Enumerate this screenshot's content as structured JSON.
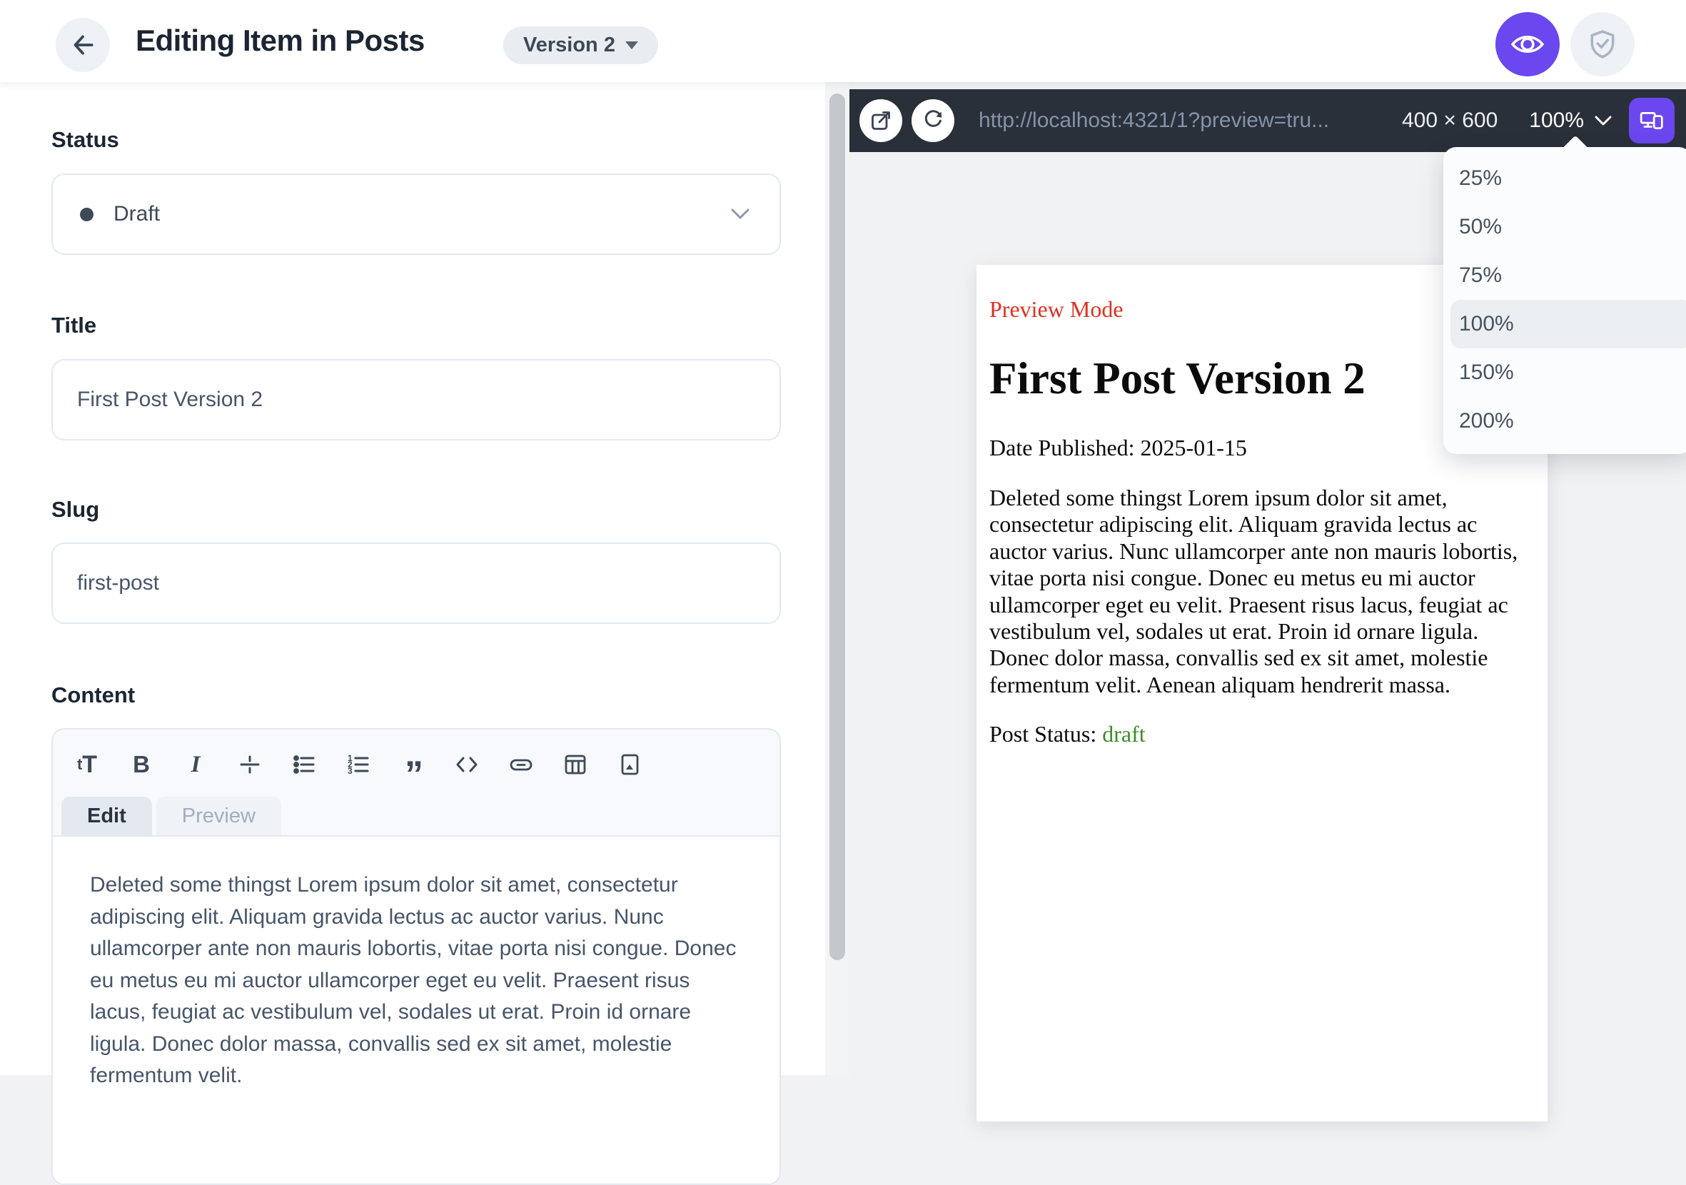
{
  "header": {
    "title": "Editing Item in Posts",
    "version_label": "Version 2"
  },
  "form": {
    "status": {
      "label": "Status",
      "value": "Draft"
    },
    "title": {
      "label": "Title",
      "value": "First Post Version 2"
    },
    "slug": {
      "label": "Slug",
      "value": "first-post"
    },
    "content": {
      "label": "Content",
      "toolbar_icons": [
        "heading",
        "bold",
        "italic",
        "strikethrough",
        "bullet-list",
        "ordered-list",
        "blockquote",
        "code",
        "link",
        "table",
        "image"
      ],
      "tabs": {
        "edit": "Edit",
        "preview": "Preview"
      },
      "value": "Deleted some thingst Lorem ipsum dolor sit amet, consectetur adipiscing elit. Aliquam gravida lectus ac auctor varius. Nunc ullamcorper ante non mauris lobortis, vitae porta nisi congue. Donec eu metus eu mi auctor ullamcorper eget eu velit. Praesent risus lacus, feugiat ac vestibulum vel, sodales ut erat. Proin id ornare ligula. Donec dolor massa, convallis sed ex sit amet, molestie fermentum velit."
    }
  },
  "preview": {
    "toolbar": {
      "url": "http://localhost:4321/1?preview=tru...",
      "dimensions": "400 × 600",
      "zoom": "100%"
    },
    "zoom_menu": {
      "options": [
        "25%",
        "50%",
        "75%",
        "100%",
        "150%",
        "200%"
      ],
      "selected": "100%"
    },
    "page": {
      "preview_mode": "Preview Mode",
      "heading": "First Post Version 2",
      "date": "Date Published: 2025-01-15",
      "body": "Deleted some thingst Lorem ipsum dolor sit amet, consectetur adipiscing elit. Aliquam gravida lectus ac auctor varius. Nunc ullamcorper ante non mauris lobortis, vitae porta nisi congue. Donec eu metus eu mi auctor ullamcorper eget eu velit. Praesent risus lacus, feugiat ac vestibulum vel, sodales ut erat. Proin id ornare ligula. Donec dolor massa, convallis sed ex sit amet, molestie fermentum velit. Aenean aliquam hendrerit massa.",
      "status_label": "Post Status: ",
      "status_value": "draft"
    }
  },
  "colors": {
    "accent_purple": "#6A47EF",
    "toolbar_dark": "#2A303A",
    "preview_mode_red": "#DF3120",
    "draft_green": "#3C8C28"
  }
}
